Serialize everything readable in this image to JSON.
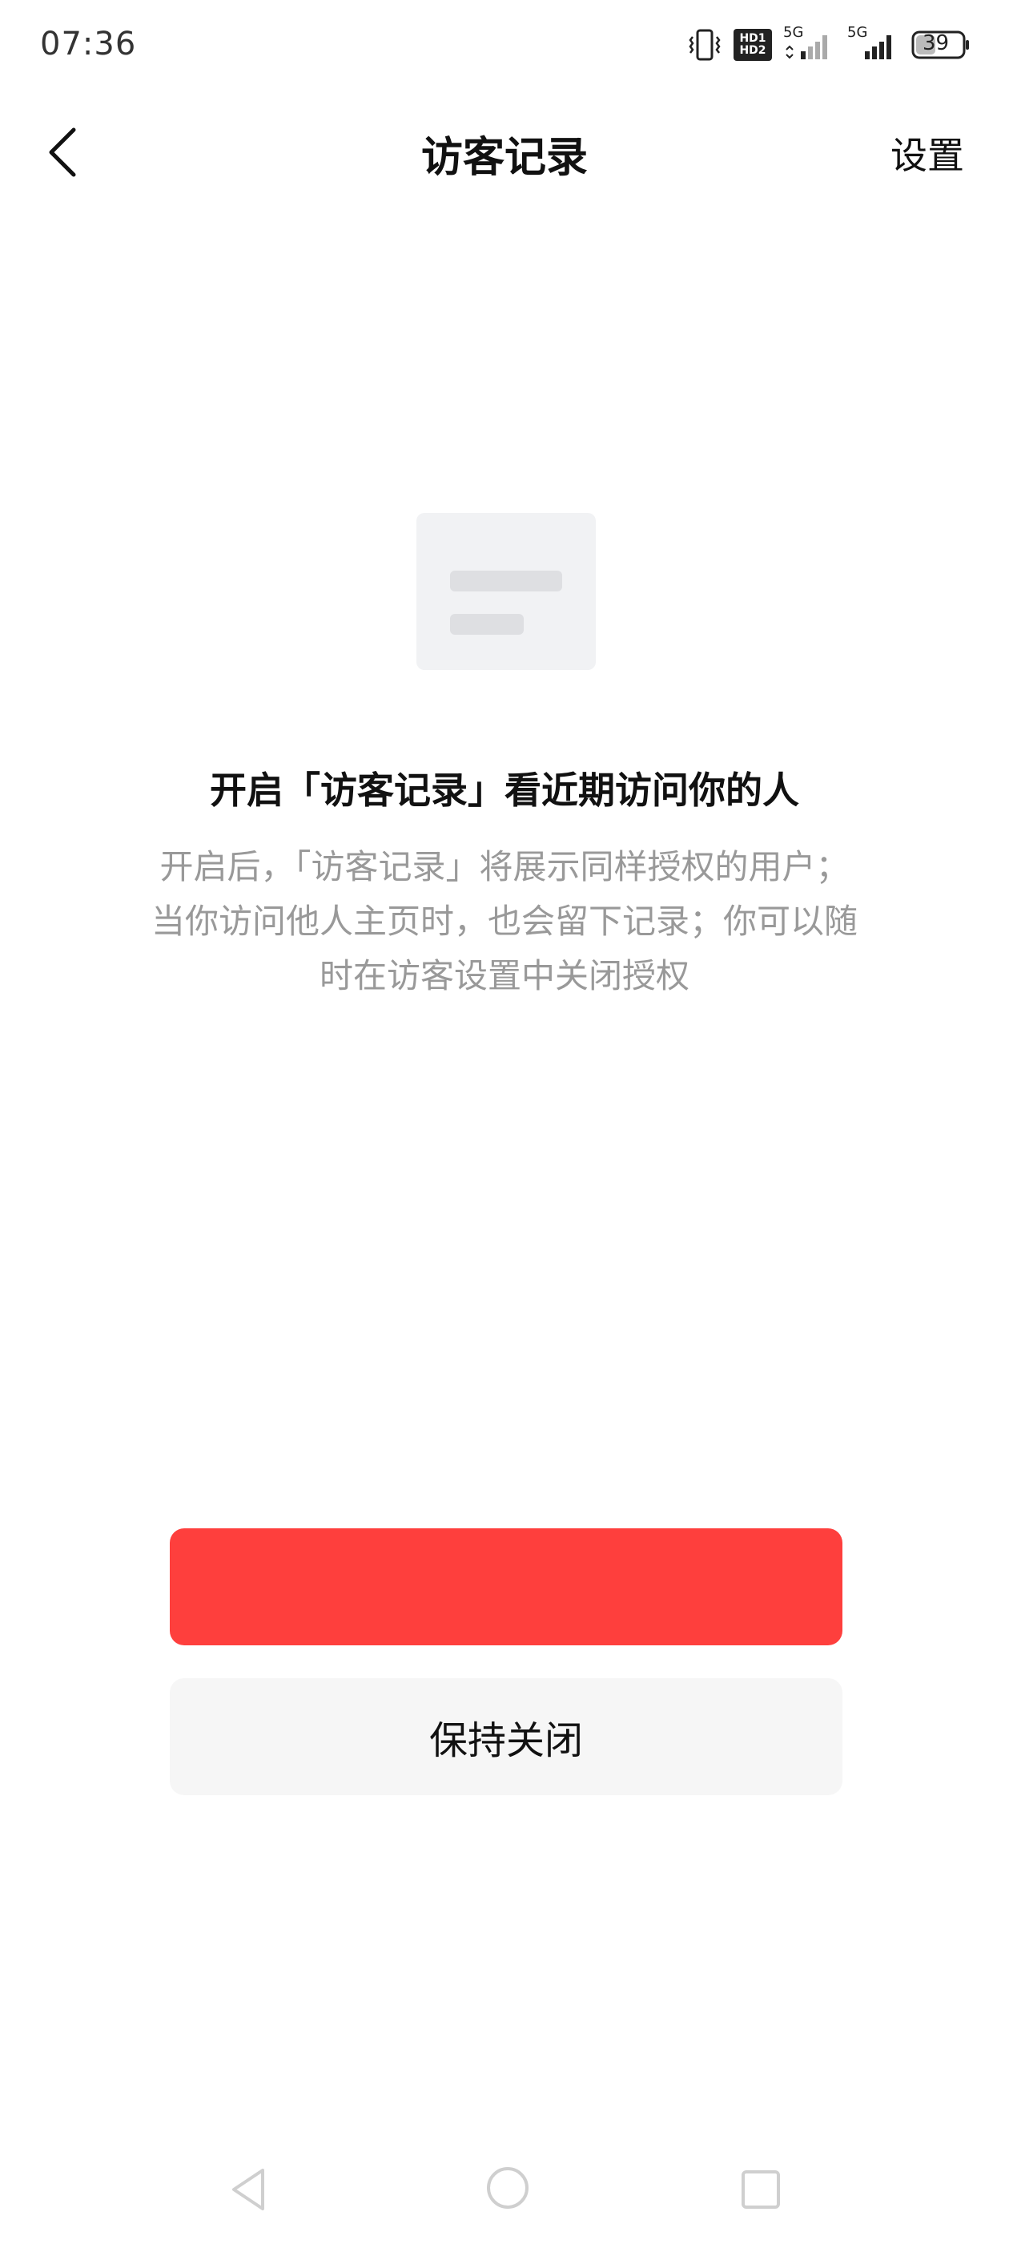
{
  "status_bar": {
    "time": "07:36",
    "battery": "39",
    "network_1": "5G",
    "network_2": "5G",
    "hd_1": "HD1",
    "hd_2": "HD2"
  },
  "header": {
    "title": "访客记录",
    "settings_label": "设置"
  },
  "empty_state": {
    "headline": "开启「访客记录」看近期访问你的人",
    "description_lines": [
      "开启后，「访客记录」将展示同样授权的用户；",
      "当你访问他人主页时，也会留下记录；你可以随",
      "时在访客设置中关闭授权"
    ]
  },
  "actions": {
    "primary_label": "",
    "secondary_label": "保持关闭"
  },
  "colors": {
    "primary_button": "#fe3f3d",
    "secondary_button": "#f6f6f6",
    "description_text": "#999999"
  }
}
